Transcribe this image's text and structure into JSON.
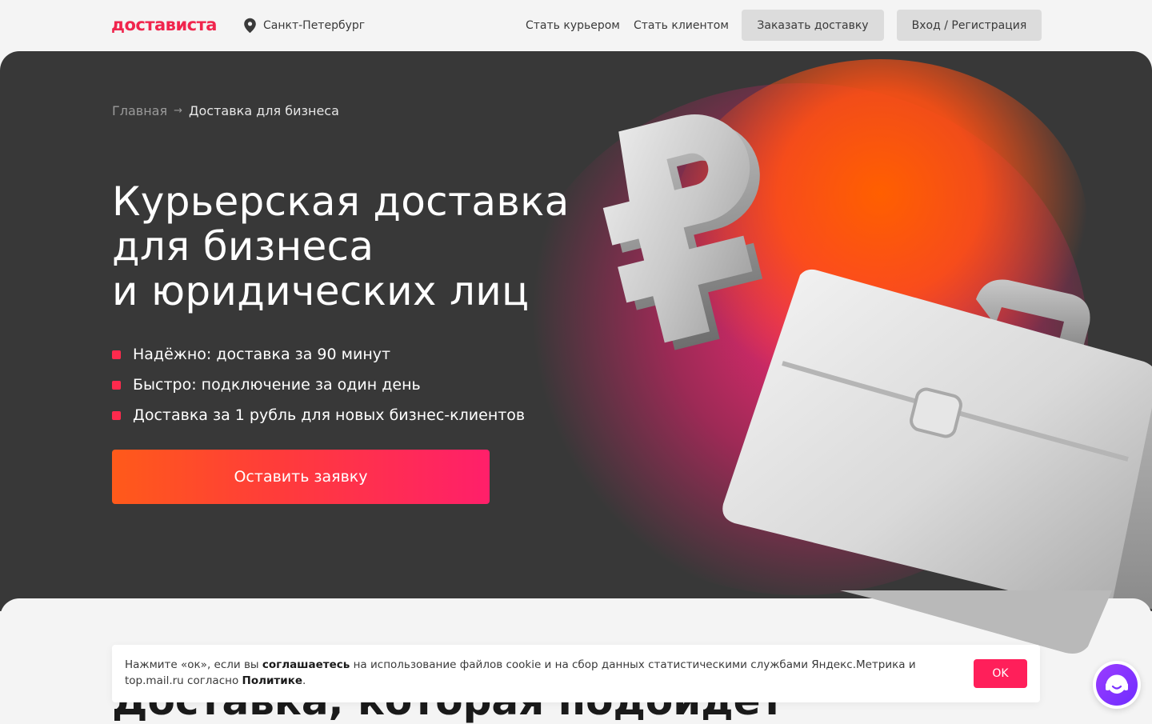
{
  "header": {
    "logo_text": "достависта",
    "city": "Санкт-Петербург",
    "nav": {
      "become_courier": "Стать курьером",
      "become_client": "Стать клиентом"
    },
    "order_delivery_label": "Заказать доставку",
    "login_label": "Вход / Регистрация"
  },
  "hero": {
    "breadcrumbs": {
      "home": "Главная",
      "separator": "→",
      "current": "Доставка для бизнеса"
    },
    "title_lines": [
      "Курьерская доставка",
      "для бизнеса",
      "и юридических лиц"
    ],
    "bullets": [
      "Надёжно: доставка за 90 минут",
      "Быстро: подключение за один день",
      "Доставка за 1 рубль для новых бизнес-клиентов"
    ],
    "cta_label": "Оставить заявку",
    "illustrations": [
      "ruble-sign-icon",
      "briefcase-icon"
    ]
  },
  "section2": {
    "title": "Доставка, которая подойдет"
  },
  "cookie": {
    "text_part1": "Нажмите «ок», если вы ",
    "text_bold1": "соглашаетесь",
    "text_part2": " на использование файлов cookie и на сбор данных статистическими службами Яндекс.Метрика и top.mail.ru согласно ",
    "text_bold2": "Политике",
    "text_part3": ".",
    "ok_label": "OK"
  },
  "chat": {
    "icon": "support-headset-icon"
  },
  "colors": {
    "brand": "#f0254d",
    "hero_bg": "#383838",
    "page_bg": "#f4f4f4",
    "cta_gradient_start": "#ff5a1a",
    "cta_gradient_end": "#ff1f6a",
    "cookie_ok": "#ff1f5a",
    "chat_accent": "#8a35ff"
  }
}
